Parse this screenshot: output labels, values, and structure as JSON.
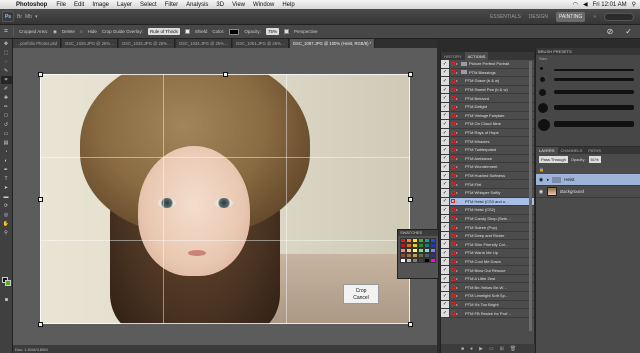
{
  "menubar": {
    "app": "Photoshop",
    "items": [
      "File",
      "Edit",
      "Image",
      "Layer",
      "Select",
      "Filter",
      "Analysis",
      "3D",
      "View",
      "Window",
      "Help"
    ],
    "clock": "Fri 12:01 AM"
  },
  "appbar": {
    "logo": "Ps",
    "workspaces": [
      "ESSENTIALS",
      "DESIGN",
      "PAINTING"
    ],
    "active_workspace": "PAINTING"
  },
  "options": {
    "cropped_area": "Cropped Area:",
    "delete": "Delete",
    "hide": "Hide",
    "overlay_label": "Crop Guide Overlay:",
    "overlay_value": "Rule of Thirds",
    "shield": "Shield",
    "color": "Color:",
    "opacity_label": "Opacity:",
    "opacity": "75%",
    "perspective": "Perspective"
  },
  "doc_tabs": [
    "…portfolio Photos.psd",
    "DSC_1025.JPG @ 25%…",
    "DSC_1032.JPG @ 25%…",
    "DSC_1034.JPG @ 25%…",
    "DSC_1051.JPG @ 25%…",
    "DSC_1067.JPG @ 100% (Heist, RGB/8) *"
  ],
  "active_doc": "DSC_1067.JPG @ 100% (Heist, RGB/8) *",
  "crop_menu": {
    "crop": "Crop",
    "cancel": "Cancel"
  },
  "swatches_title": "SWATCHES",
  "swatch_colors": [
    "#e21c1c",
    "#f08a1c",
    "#f7e21c",
    "#4caf2a",
    "#1c9c9c",
    "#1c4ce2",
    "#b21c1c",
    "#d96a1c",
    "#e2d21c",
    "#2a8a2a",
    "#1c7a7a",
    "#1c3ab2",
    "#ff8080",
    "#ffc080",
    "#ffff80",
    "#80e080",
    "#80e0e0",
    "#8080ff",
    "#8a4a2a",
    "#a07040",
    "#c0a060",
    "#607040",
    "#406070",
    "#403070",
    "#ffffff",
    "#c0c0c0",
    "#808080",
    "#404040",
    "#000000",
    "#ff00ff"
  ],
  "status": "Doc: 1.51M/3.89M",
  "actions": {
    "tabs": [
      "HISTORY",
      "ACTIONS"
    ],
    "active_tab": "ACTIONS",
    "items": [
      "Picture Perfect Portrait",
      "PTM Blessings",
      "PTM Grace (b & w)",
      "PTM Sweet Pea (b & w)",
      "PTM Beloved",
      "PTM Delight",
      "PTM Vintage Fairytale",
      "PTM On Cloud Nine",
      "PTM Rays of Hope",
      "PTM Miracles",
      "PTM Twitterpated",
      "PTM Ambiance",
      "PTM Wonderment",
      "PTM Hushed Softness",
      "PTM Flirt",
      "PTM Whisper Softly",
      "PTM Heist (CS3 and u…",
      "PTM Heist (CS2)",
      "PTM Candy Shop (Sele…",
      "PTM Soiree (Pop)",
      "PTM Deep and Richer",
      "PTM Skin Friendly Col…",
      "PTM Warm Me Up",
      "PTM Cool Me Down",
      "PTM Blow Out Rescue",
      "PTM A Little Zest",
      "PTM Be-Yellow Be-W…",
      "PTM Limelight Soft Sp…",
      "PTM It's Too Bright",
      "PTM FB Resize for Prof…"
    ],
    "selected": "PTM Heist (CS3 and u…"
  },
  "brush": {
    "title": "BRUSH PRESETS",
    "size_label": "Size:"
  },
  "layers": {
    "tabs": [
      "LAYERS",
      "CHANNELS",
      "PATHS"
    ],
    "blend": "Pass Through",
    "opacity_label": "Opacity:",
    "opacity": "51%",
    "rows": [
      "Heist",
      "Background"
    ]
  }
}
